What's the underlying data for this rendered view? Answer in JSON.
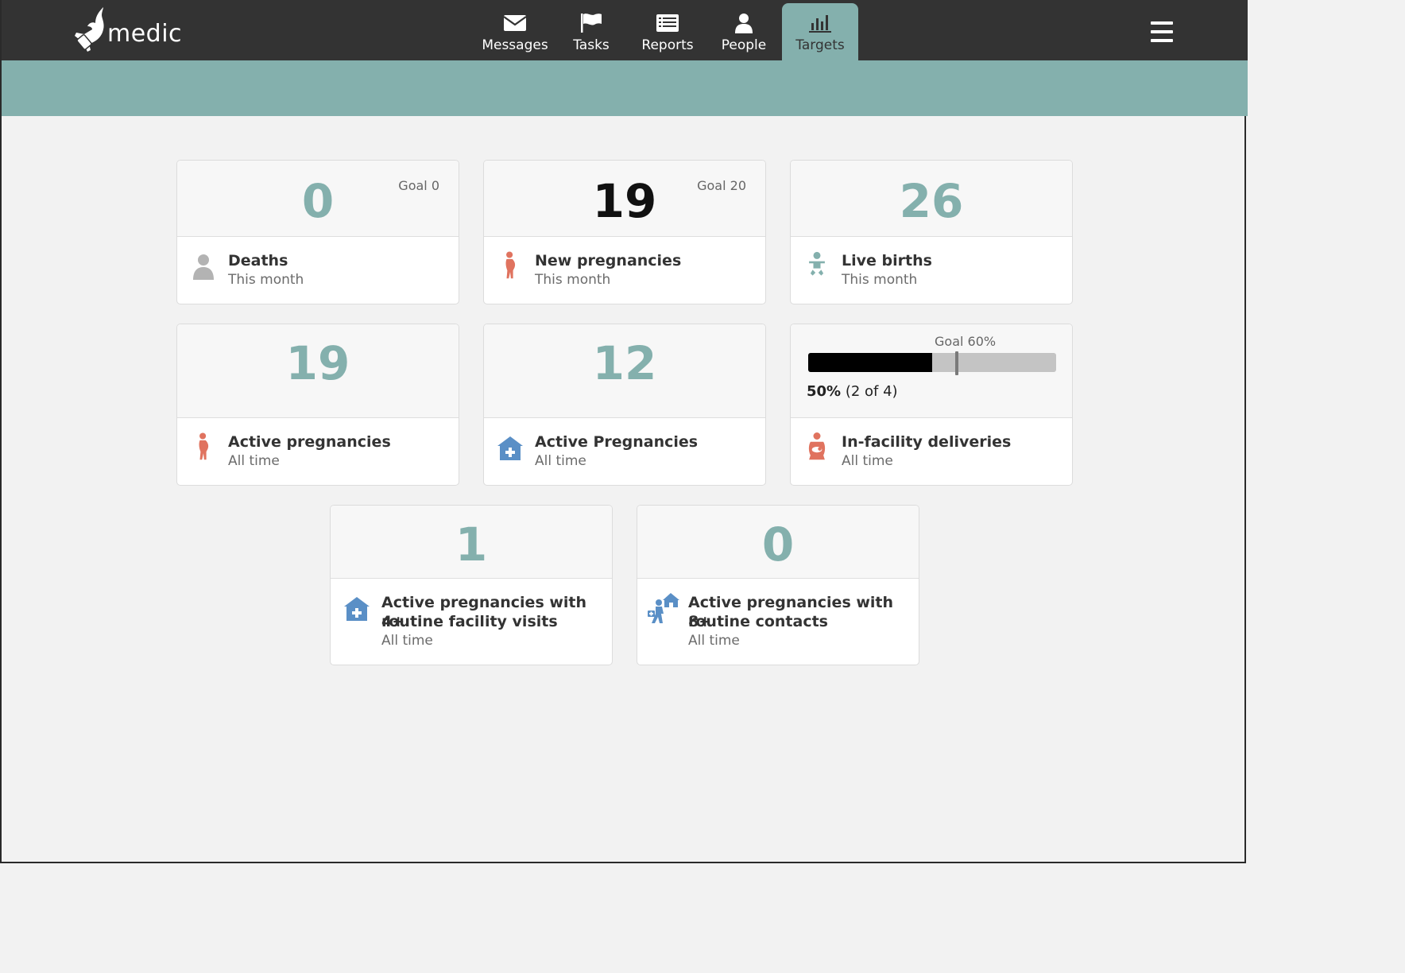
{
  "app": {
    "brand": "medic"
  },
  "nav": {
    "items": [
      {
        "label": "Messages",
        "icon": "envelope-icon"
      },
      {
        "label": "Tasks",
        "icon": "flag-icon"
      },
      {
        "label": "Reports",
        "icon": "list-icon"
      },
      {
        "label": "People",
        "icon": "person-icon"
      },
      {
        "label": "Targets",
        "icon": "bar-chart-icon",
        "active": true
      }
    ]
  },
  "colors": {
    "accent": "#84b0ad",
    "topbar": "#333333",
    "coral": "#e0735f",
    "blue": "#5a8fc6"
  },
  "targets": [
    {
      "value": "0",
      "goal": "Goal 0",
      "title": "Deaths",
      "period": "This month",
      "icon": "person-icon"
    },
    {
      "value": "19",
      "goal": "Goal 20",
      "title": "New pregnancies",
      "period": "This month",
      "icon": "pregnant-woman-icon"
    },
    {
      "value": "26",
      "goal": "",
      "title": "Live births",
      "period": "This month",
      "icon": "baby-icon"
    },
    {
      "value": "19",
      "goal": "",
      "title": "Active pregnancies",
      "period": "All time",
      "icon": "pregnant-woman-icon"
    },
    {
      "value": "12",
      "goal": "",
      "title": "Active Pregnancies",
      "period": "All time",
      "icon": "health-facility-icon"
    },
    {
      "goal": "Goal 60%",
      "percent_label": "50%",
      "count_label": "(2 of 4)",
      "progress": 0.5,
      "goal_fraction": 0.6,
      "title": "In-facility deliveries",
      "period": "All time",
      "icon": "mother-baby-icon"
    },
    {
      "value": "1",
      "goal": "",
      "title_line1": "Active pregnancies with 4+",
      "title_line2": "routine facility visits",
      "period": "All time",
      "icon": "health-facility-icon"
    },
    {
      "value": "0",
      "goal": "",
      "title_line1": "Active pregnancies with 8+",
      "title_line2": "routine contacts",
      "period": "All time",
      "icon": "home-visit-icon"
    }
  ]
}
